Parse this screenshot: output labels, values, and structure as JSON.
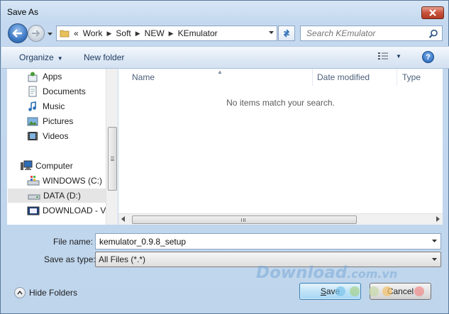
{
  "window": {
    "title": "Save As"
  },
  "address": {
    "overflow": "«",
    "crumbs": [
      "Work",
      "Soft",
      "NEW",
      "KEmulator"
    ],
    "sep": "▶"
  },
  "search": {
    "placeholder": "Search KEmulator"
  },
  "toolbar": {
    "organize_label": "Organize",
    "new_folder_label": "New folder"
  },
  "nav": {
    "items": [
      {
        "label": "Apps",
        "icon": "apps-icon"
      },
      {
        "label": "Documents",
        "icon": "documents-icon"
      },
      {
        "label": "Music",
        "icon": "music-icon"
      },
      {
        "label": "Pictures",
        "icon": "pictures-icon"
      },
      {
        "label": "Videos",
        "icon": "videos-icon"
      },
      {
        "label": "Computer",
        "icon": "computer-icon"
      },
      {
        "label": "WINDOWS (C:)",
        "icon": "drive-c-icon"
      },
      {
        "label": "DATA (D:)",
        "icon": "drive-d-icon",
        "selected": true
      },
      {
        "label": "DOWNLOAD - VI",
        "icon": "drive-download-icon"
      }
    ]
  },
  "filelist": {
    "columns": [
      "Name",
      "Date modified",
      "Type"
    ],
    "empty_message": "No items match your search."
  },
  "form": {
    "file_name_label": "File name:",
    "file_name_value": "kemulator_0.9.8_setup",
    "save_type_label": "Save as type:",
    "save_type_value": "All Files (*.*)"
  },
  "footer": {
    "hide_folders_label": "Hide Folders",
    "save_label": "Save",
    "cancel_label": "Cancel"
  },
  "watermark": {
    "main": "Download",
    "sub": ".com.vn"
  },
  "colors": {
    "accent": "#3c7fb1",
    "close": "#c8523c"
  }
}
